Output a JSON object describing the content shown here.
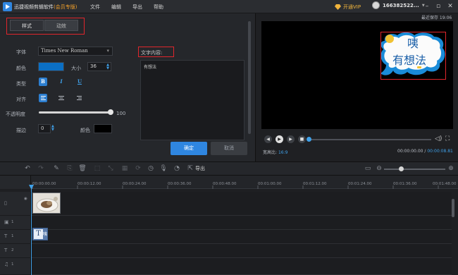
{
  "titlebar": {
    "app_name": "迅捷视频剪辑软件",
    "edition": "(会员专版)",
    "menus": [
      "文件",
      "编辑",
      "导出",
      "帮助"
    ],
    "vip_label": "开通VIP",
    "username": "166382522...",
    "window_buttons": [
      "minimize-icon",
      "maximize-icon",
      "close-icon"
    ]
  },
  "panel": {
    "tabs": [
      "样式",
      "动效"
    ],
    "font_label": "字体",
    "font_value": "Times New Roman",
    "color_label": "颜色",
    "color_value": "#0b6fc4",
    "size_label": "大小",
    "size_value": "36",
    "type_label": "类型",
    "type_buttons": [
      "B",
      "I",
      "U"
    ],
    "align_label": "对齐",
    "opacity_label": "不透明度",
    "opacity_value": "100",
    "opacity_level": 1.0,
    "stroke_label": "描边",
    "stroke_value": "0",
    "stroke_color_label": "颜色",
    "stroke_color_value": "#000000",
    "text_content_label": "文字内容:",
    "text_content_value": "有想法",
    "ok_button": "确定",
    "cancel_button": "取消"
  },
  "preview": {
    "saved_label": "最近保存 19:06",
    "bubble_line1": "咦",
    "bubble_line2": "有想法",
    "ratio_label": "宽高比:",
    "ratio_value": "16:9",
    "current_time": "00:00:00.00",
    "separator": " / ",
    "total_time": "00:00:08.81",
    "progress": 0.0
  },
  "toolbar": {
    "export_label": "导出",
    "zoom_level": 0.25
  },
  "timeline": {
    "ruler_ticks": [
      "00:00:00.00",
      "00:00:12.00",
      "00:00:24.00",
      "00:00:36.00",
      "00:00:48.00",
      "00:01:00.00",
      "00:01:12.00",
      "00:01:24.00",
      "00:01:36.00",
      "00:01:48.00",
      "00:02:00.00"
    ],
    "tracks": [
      {
        "icon": "image-track-icon",
        "number": ""
      },
      {
        "icon": "video-track-icon",
        "number": "1"
      },
      {
        "icon": "text-track-icon",
        "number": "1"
      },
      {
        "icon": "text-track-icon",
        "number": "2"
      },
      {
        "icon": "music-track-icon",
        "number": "1"
      }
    ],
    "text_clip_letter": "T",
    "text_clip_label": "咦"
  },
  "colors": {
    "accent": "#3fa0e8",
    "primary_button": "#2f86e0",
    "highlight_box": "#e0262c",
    "vip_gold": "#f1b43c"
  }
}
